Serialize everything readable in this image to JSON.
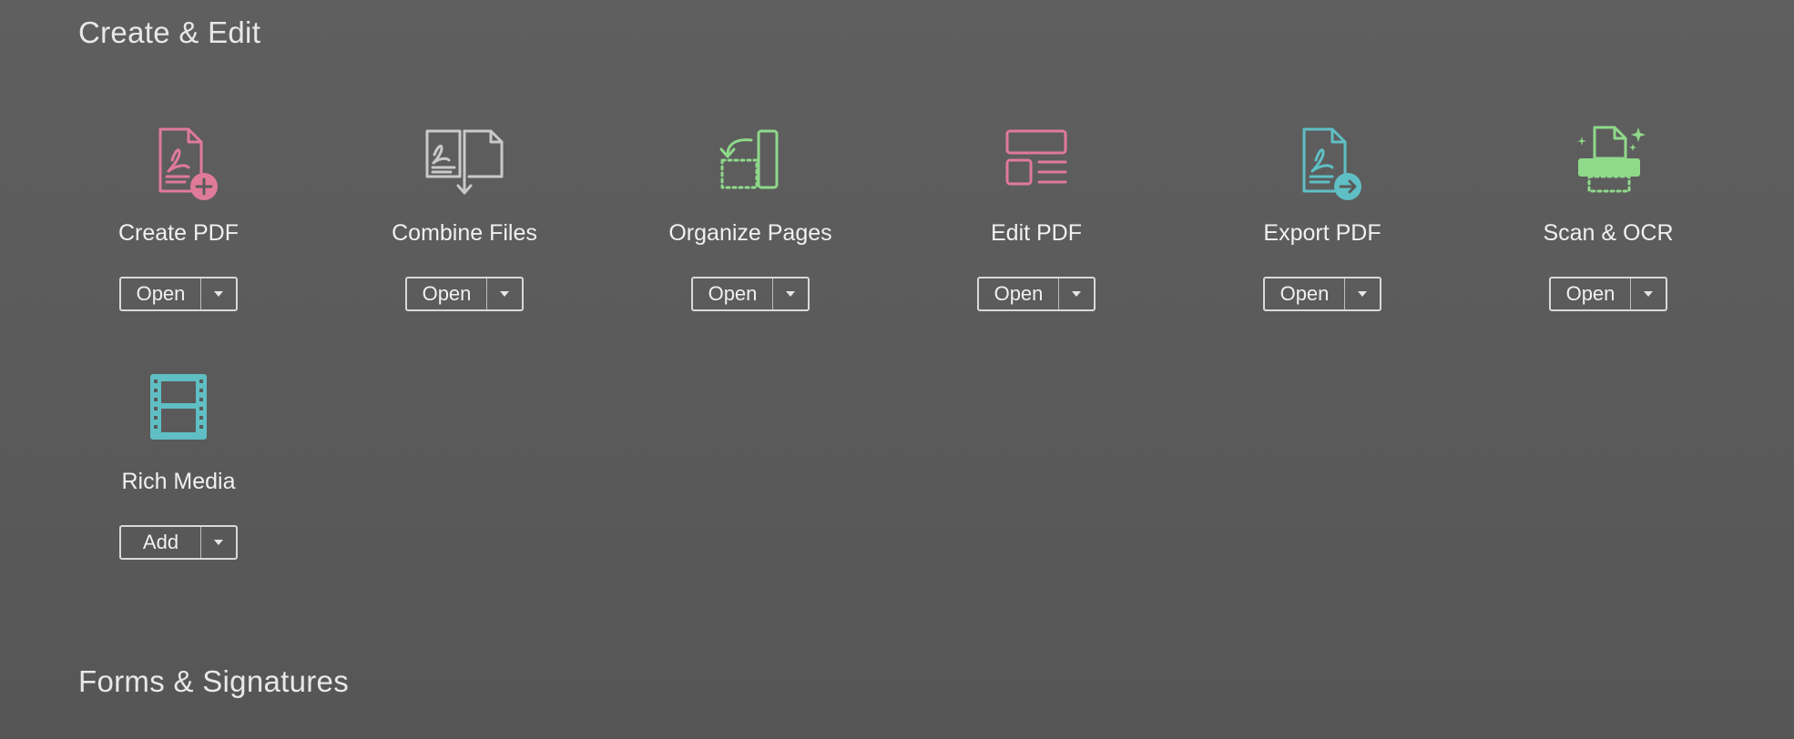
{
  "sections": {
    "create_edit": {
      "title": "Create & Edit"
    },
    "forms_signatures": {
      "title": "Forms & Signatures"
    }
  },
  "tools": [
    {
      "label": "Create PDF",
      "button": "Open",
      "icon": "create-pdf-icon",
      "color": "#e07a9a"
    },
    {
      "label": "Combine Files",
      "button": "Open",
      "icon": "combine-files-icon",
      "color": "#c9c9c9"
    },
    {
      "label": "Organize Pages",
      "button": "Open",
      "icon": "organize-pages-icon",
      "color": "#8fd98a"
    },
    {
      "label": "Edit PDF",
      "button": "Open",
      "icon": "edit-pdf-icon",
      "color": "#e07a9a"
    },
    {
      "label": "Export PDF",
      "button": "Open",
      "icon": "export-pdf-icon",
      "color": "#5fbfc4"
    },
    {
      "label": "Scan & OCR",
      "button": "Open",
      "icon": "scan-ocr-icon",
      "color": "#8fd98a"
    },
    {
      "label": "Rich Media",
      "button": "Add",
      "icon": "rich-media-icon",
      "color": "#5fbfc4"
    }
  ]
}
